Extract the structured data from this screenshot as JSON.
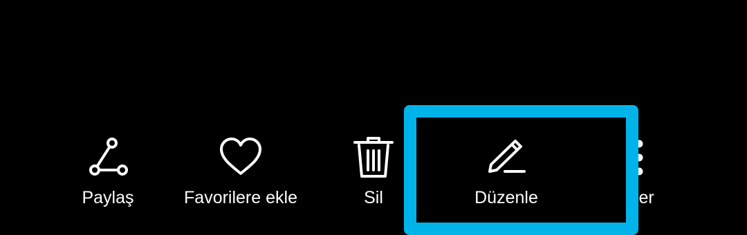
{
  "toolbar": {
    "actions": [
      {
        "label": "Paylaş",
        "icon": "share-icon"
      },
      {
        "label": "Favorilere ekle",
        "icon": "heart-icon"
      },
      {
        "label": "Sil",
        "icon": "trash-icon"
      },
      {
        "label": "Düzenle",
        "icon": "pencil-icon"
      },
      {
        "label": "iğer",
        "icon": "more-vertical-icon"
      }
    ],
    "highlighted_action": "Düzenle"
  },
  "colors": {
    "background": "#000000",
    "foreground": "#ffffff",
    "highlight": "#00b4ea"
  }
}
